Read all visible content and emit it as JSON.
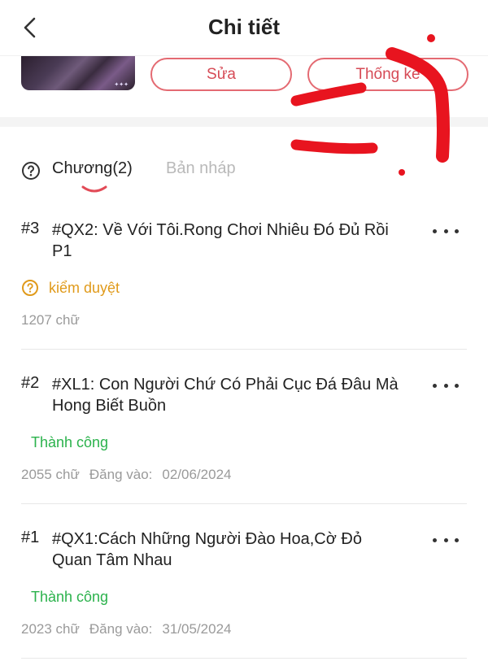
{
  "header": {
    "title": "Chi tiết",
    "back_icon": "chevron-left-icon"
  },
  "actions": {
    "edit_label": "Sửa",
    "stats_label": "Thống kê"
  },
  "colors": {
    "accent": "#d64b56",
    "success": "#2bb24c",
    "warning": "#e09a1a",
    "muted": "#9a9a9a"
  },
  "tabs": [
    {
      "label": "Chương(2)",
      "active": true
    },
    {
      "label": "Bản nháp",
      "active": false
    }
  ],
  "chapters": [
    {
      "number": "#3",
      "title": "#QX2: Về Với Tôi.Rong Chơi Nhiêu Đó Đủ Rồi P1",
      "status": "kiểm duyệt",
      "status_type": "review",
      "words": "1207 chữ",
      "posted_label": "",
      "posted_date": ""
    },
    {
      "number": "#2",
      "title": "#XL1: Con Người Chứ Có Phải Cục Đá Đâu Mà Hong Biết Buồn",
      "status": "Thành công",
      "status_type": "success",
      "words": "2055 chữ",
      "posted_label": "Đăng vào:",
      "posted_date": "02/06/2024"
    },
    {
      "number": "#1",
      "title": "#QX1:Cách Những Người Đào Hoa,Cờ Đỏ Quan Tâm Nhau",
      "status": "Thành công",
      "status_type": "success",
      "words": "2023 chữ",
      "posted_label": "Đăng vào:",
      "posted_date": "31/05/2024"
    }
  ]
}
